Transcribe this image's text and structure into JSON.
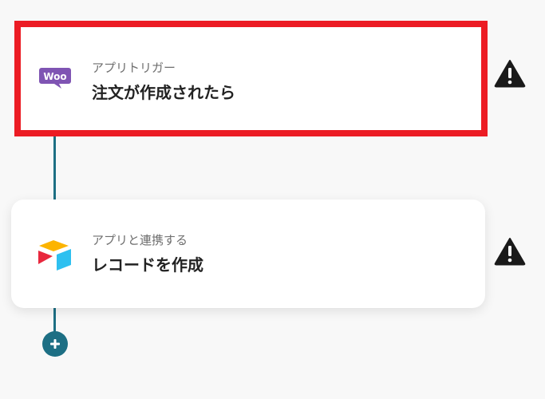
{
  "steps": [
    {
      "icon": "woocommerce-icon",
      "subtitle": "アプリトリガー",
      "title": "注文が作成されたら",
      "selected": true,
      "warning_icon": "warning-icon"
    },
    {
      "icon": "airtable-icon",
      "subtitle": "アプリと連携する",
      "title": "レコードを作成",
      "selected": false,
      "warning_icon": "warning-icon"
    }
  ],
  "add_button": {
    "icon": "plus-icon"
  },
  "colors": {
    "connector": "#1d6f84",
    "selected_border": "#ec1c24",
    "woo_purple": "#7f54b3",
    "warning": "#1a1a1a"
  }
}
